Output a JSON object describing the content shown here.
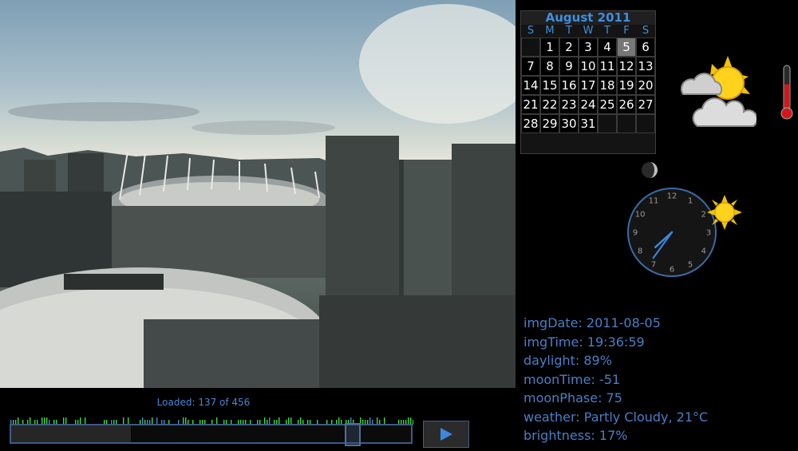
{
  "calendar": {
    "month_label": "August 2011",
    "weekdays": [
      "S",
      "M",
      "T",
      "W",
      "T",
      "F",
      "S"
    ],
    "leading_blanks": 1,
    "days": [
      "1",
      "2",
      "3",
      "4",
      "5",
      "6",
      "7",
      "8",
      "9",
      "10",
      "11",
      "12",
      "13",
      "14",
      "15",
      "16",
      "17",
      "18",
      "19",
      "20",
      "21",
      "22",
      "23",
      "24",
      "25",
      "26",
      "27",
      "28",
      "29",
      "30",
      "31"
    ],
    "today": "5",
    "today_weekday_index": 5
  },
  "loaded_text": "Loaded: 137 of 456",
  "timeline": {
    "loaded_fraction": 0.3,
    "position_fraction": 0.855
  },
  "clock": {
    "numerals": [
      "12",
      "1",
      "2",
      "3",
      "4",
      "5",
      "6",
      "7",
      "8",
      "9",
      "10",
      "11"
    ],
    "hour": 19,
    "minute": 36
  },
  "info": {
    "img_date": "imgDate: 2011-08-05",
    "img_time": "imgTime: 19:36:59",
    "daylight": "daylight: 89%",
    "moon_time": "moonTime: -51",
    "moon_phase": "moonPhase: 75",
    "weather": "weather: Partly Cloudy, 21°C",
    "brightness": "brightness: 17%"
  },
  "thermometer_level": 0.6,
  "icons": {
    "weather": "partly-cloudy-icon",
    "moon": "moon-icon",
    "sun": "sun-icon",
    "thermometer": "thermometer-icon",
    "play": "play-icon"
  },
  "colors": {
    "accent": "#4a86d6",
    "text": "#4a7fc6",
    "tick": "#38e03a",
    "thermo": "#d01818"
  }
}
